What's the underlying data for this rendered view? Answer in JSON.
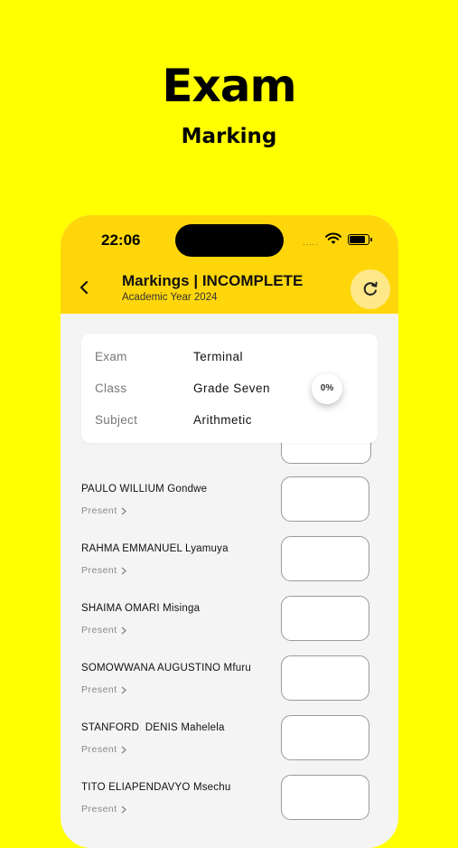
{
  "hero": {
    "title": "Exam",
    "subtitle": "Marking"
  },
  "status_bar": {
    "time": "22:06",
    "signal": "....."
  },
  "app_bar": {
    "title": "Markings  | INCOMPLETE",
    "subtitle": "Academic Year 2024"
  },
  "info": {
    "rows": [
      {
        "label": "Exam",
        "value": "Terminal"
      },
      {
        "label": "Class",
        "value": "Grade Seven"
      },
      {
        "label": "Subject",
        "value": "Arithmetic"
      }
    ],
    "progress": "0%"
  },
  "students": [
    {
      "name": "PAULO WILLIUM Gondwe",
      "status": "Present",
      "mark": ""
    },
    {
      "name": "RAHMA EMMANUEL Lyamuya",
      "status": "Present",
      "mark": ""
    },
    {
      "name": "SHAIMA OMARI Misinga",
      "status": "Present",
      "mark": ""
    },
    {
      "name": "SOMOWWANA AUGUSTINO Mfuru",
      "status": "Present",
      "mark": ""
    },
    {
      "name": "STANFORD  DENIS Mahelela",
      "status": "Present",
      "mark": ""
    },
    {
      "name": "TITO ELIAPENDAVYO Msechu",
      "status": "Present",
      "mark": ""
    }
  ],
  "colors": {
    "background": "#FFFF00",
    "app_bar": "#FFD60A",
    "refresh_button": "#FFE88A"
  }
}
